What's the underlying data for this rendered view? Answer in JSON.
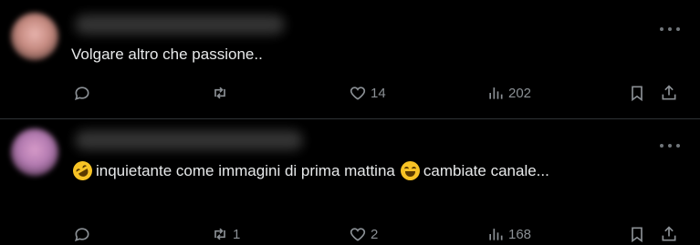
{
  "posts": [
    {
      "text": "Volgare altro che passione..",
      "replies": "",
      "reposts": "",
      "likes": "14",
      "views": "202"
    },
    {
      "text_part1": "inquietante come immagini di prima mattina",
      "text_part2": "cambiate canale...",
      "emoji1": "rolling-on-floor-laughing-emoji",
      "emoji2": "grinning-squinting-face-emoji",
      "replies": "",
      "reposts": "1",
      "likes": "2",
      "views": "168"
    }
  ],
  "colors": {
    "background": "#000000",
    "text": "#e7e9ea",
    "muted": "#71767b",
    "divider": "#2f3336"
  }
}
